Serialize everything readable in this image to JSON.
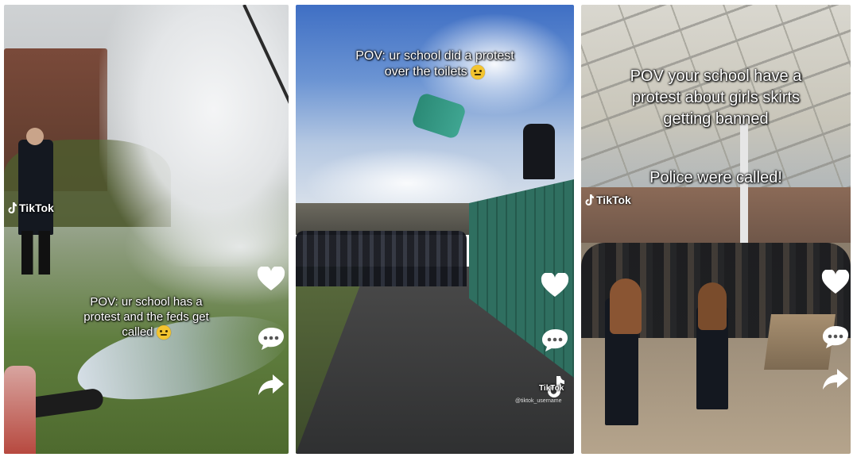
{
  "panels": [
    {
      "watermark": "TikTok",
      "caption_lines": [
        "POV: ur school has a",
        "protest and the feds get",
        "called"
      ],
      "icons": [
        "heart-icon",
        "comment-icon",
        "share-icon"
      ]
    },
    {
      "caption_lines": [
        "POV: ur school did a protest",
        "over the toilets"
      ],
      "watermark_small": "TikTok",
      "username": "@tiktok_username",
      "icons": [
        "heart-icon",
        "comment-icon",
        "share-icon"
      ]
    },
    {
      "watermark": "TikTok",
      "caption_lines": [
        "POV your school have a",
        "protest about girls skirts",
        "getting banned"
      ],
      "caption_extra": "Police were called!",
      "icons": [
        "heart-icon",
        "comment-icon",
        "share-icon"
      ]
    }
  ],
  "colors": {
    "icon": "#ffffff",
    "caption_text": "#ffffff",
    "portaloo": "#2f8a78"
  }
}
